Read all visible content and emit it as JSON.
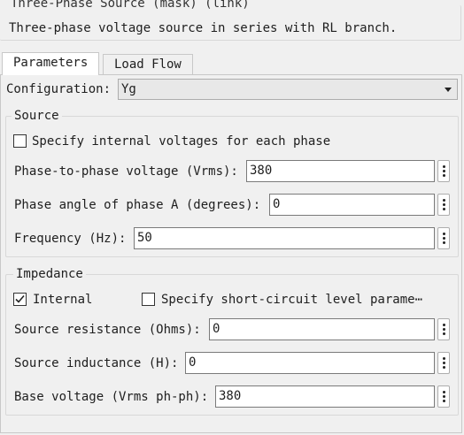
{
  "mask": {
    "title": "Three-Phase Source (mask) (link)",
    "description": "Three-phase voltage source in series with RL branch."
  },
  "tabs": [
    {
      "label": "Parameters",
      "active": true
    },
    {
      "label": "Load Flow",
      "active": false
    }
  ],
  "configuration": {
    "label": "Configuration:",
    "value": "Yg"
  },
  "source": {
    "title": "Source",
    "specify_internal": {
      "label": "Specify internal voltages for each phase",
      "checked": false
    },
    "voltage": {
      "label": "Phase-to-phase voltage (Vrms):",
      "value": "380"
    },
    "phase_angle": {
      "label": "Phase angle of phase A (degrees):",
      "value": "0"
    },
    "frequency": {
      "label": "Frequency (Hz):",
      "value": "50"
    }
  },
  "impedance": {
    "title": "Impedance",
    "internal": {
      "label": "Internal",
      "checked": true
    },
    "short_circuit": {
      "label": "Specify short-circuit level parame⋯",
      "checked": false
    },
    "resistance": {
      "label": "Source resistance (Ohms):",
      "value": "0"
    },
    "inductance": {
      "label": "Source inductance (H):",
      "value": "0"
    },
    "base_voltage": {
      "label": "Base voltage (Vrms ph-ph):",
      "value": "380"
    }
  },
  "colors": {
    "background": "#f0f0f0",
    "field_border": "#7a7a7a",
    "group_border": "#d8d8d8"
  }
}
